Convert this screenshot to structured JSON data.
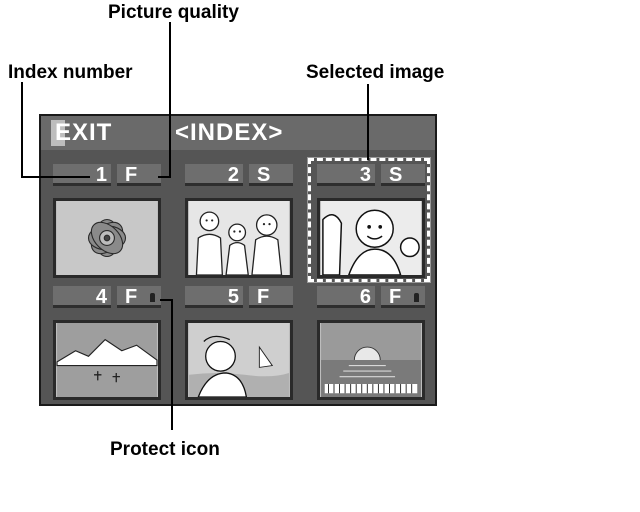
{
  "callouts": {
    "picture_quality": "Picture quality",
    "index_number": "Index number",
    "selected_image": "Selected image",
    "protect_icon": "Protect icon"
  },
  "screen": {
    "exit_label": "EXIT",
    "title": "<INDEX>"
  },
  "thumbnails": [
    {
      "index": "1",
      "quality": "F",
      "protected": false,
      "scene": "flower"
    },
    {
      "index": "2",
      "quality": "S",
      "protected": false,
      "scene": "family"
    },
    {
      "index": "3",
      "quality": "S",
      "protected": false,
      "scene": "children",
      "selected": true
    },
    {
      "index": "4",
      "quality": "F",
      "protected": true,
      "scene": "mountains"
    },
    {
      "index": "5",
      "quality": "F",
      "protected": false,
      "scene": "girl-by-sea"
    },
    {
      "index": "6",
      "quality": "F",
      "protected": true,
      "scene": "sunset"
    }
  ]
}
